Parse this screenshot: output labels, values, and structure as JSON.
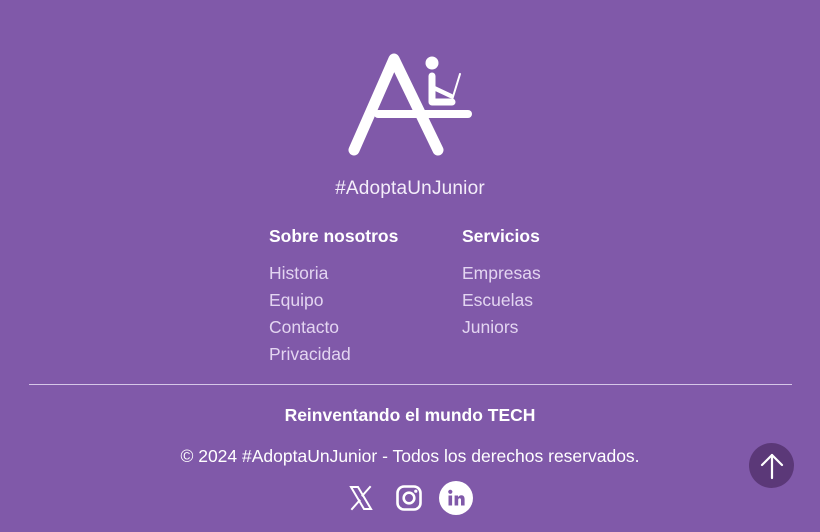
{
  "brand": {
    "tagline": "#AdoptaUnJunior",
    "logo_icon": "adopta-logo-icon"
  },
  "columns": [
    {
      "title": "Sobre nosotros",
      "links": [
        "Historia",
        "Equipo",
        "Contacto",
        "Privacidad"
      ]
    },
    {
      "title": "Servicios",
      "links": [
        "Empresas",
        "Escuelas",
        "Juniors"
      ]
    }
  ],
  "footer": {
    "slogan": "Reinventando el mundo TECH",
    "copyright": "© 2024 #AdoptaUnJunior - Todos los derechos reservados."
  },
  "socials": [
    {
      "icon": "x-twitter-icon"
    },
    {
      "icon": "instagram-icon"
    },
    {
      "icon": "linkedin-icon"
    }
  ],
  "scroll_top": {
    "icon": "arrow-up-icon"
  },
  "colors": {
    "background": "#8059a9",
    "link": "#e3d5f1",
    "scroll_button": "#5b3878",
    "linkedin_text": "#8059a9"
  }
}
